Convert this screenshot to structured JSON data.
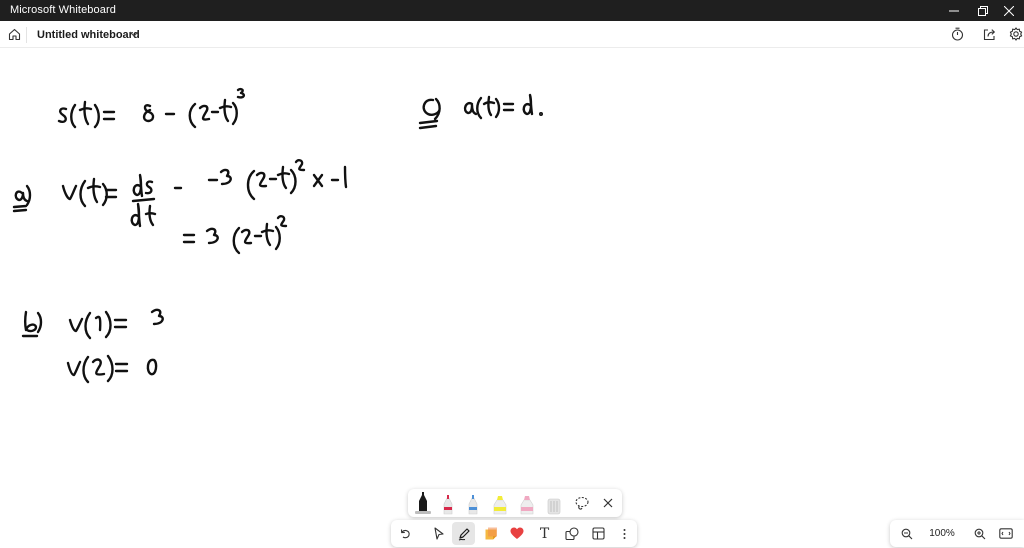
{
  "window": {
    "title": "Microsoft Whiteboard",
    "controls": [
      "minimize-icon",
      "restore-icon",
      "close-icon"
    ]
  },
  "header": {
    "home_icon": "home-icon",
    "board_title": "Untitled whiteboard",
    "right_icons": [
      "timer-icon",
      "share-icon",
      "settings-icon"
    ]
  },
  "canvas": {
    "handwriting": {
      "line_1": "s(t) = 8 − (2−t)³",
      "line_2": "a) v(t) = ds/dt = −3 (2−t)² × −1",
      "line_3": "= 3 (2−t)²",
      "line_4": "b) v(1) = 3",
      "line_5": "v(2) = 0",
      "line_6": "c) a(t) = d."
    },
    "ink_color": "#111111"
  },
  "pen_tray": {
    "pens": [
      {
        "name": "black-pen",
        "color": "#1a1a1a",
        "selected": true
      },
      {
        "name": "red-pen",
        "color": "#d6294a",
        "selected": false
      },
      {
        "name": "blue-pen",
        "color": "#4c8fd6",
        "selected": false
      },
      {
        "name": "yellow-highlighter",
        "color": "#f2ec3a",
        "selected": false
      },
      {
        "name": "pink-highlighter",
        "color": "#f0a9c2",
        "selected": false
      },
      {
        "name": "eraser",
        "color": "#d9d9d9",
        "selected": false
      }
    ],
    "lasso_icon": "lasso-icon",
    "close_icon": "close-icon"
  },
  "toolbar": {
    "tools": [
      {
        "name": "undo-icon"
      },
      {
        "name": "select-arrow-icon"
      },
      {
        "name": "pen-icon",
        "active": true
      },
      {
        "name": "sticky-note-icon"
      },
      {
        "name": "reactions-heart-icon"
      },
      {
        "name": "text-icon",
        "label": "T"
      },
      {
        "name": "shapes-icon"
      },
      {
        "name": "templates-icon"
      }
    ]
  },
  "zoom": {
    "level": "100%",
    "zoom_out_icon": "zoom-out-icon",
    "zoom_in_icon": "zoom-in-icon",
    "fit_icon": "fit-to-screen-icon"
  }
}
